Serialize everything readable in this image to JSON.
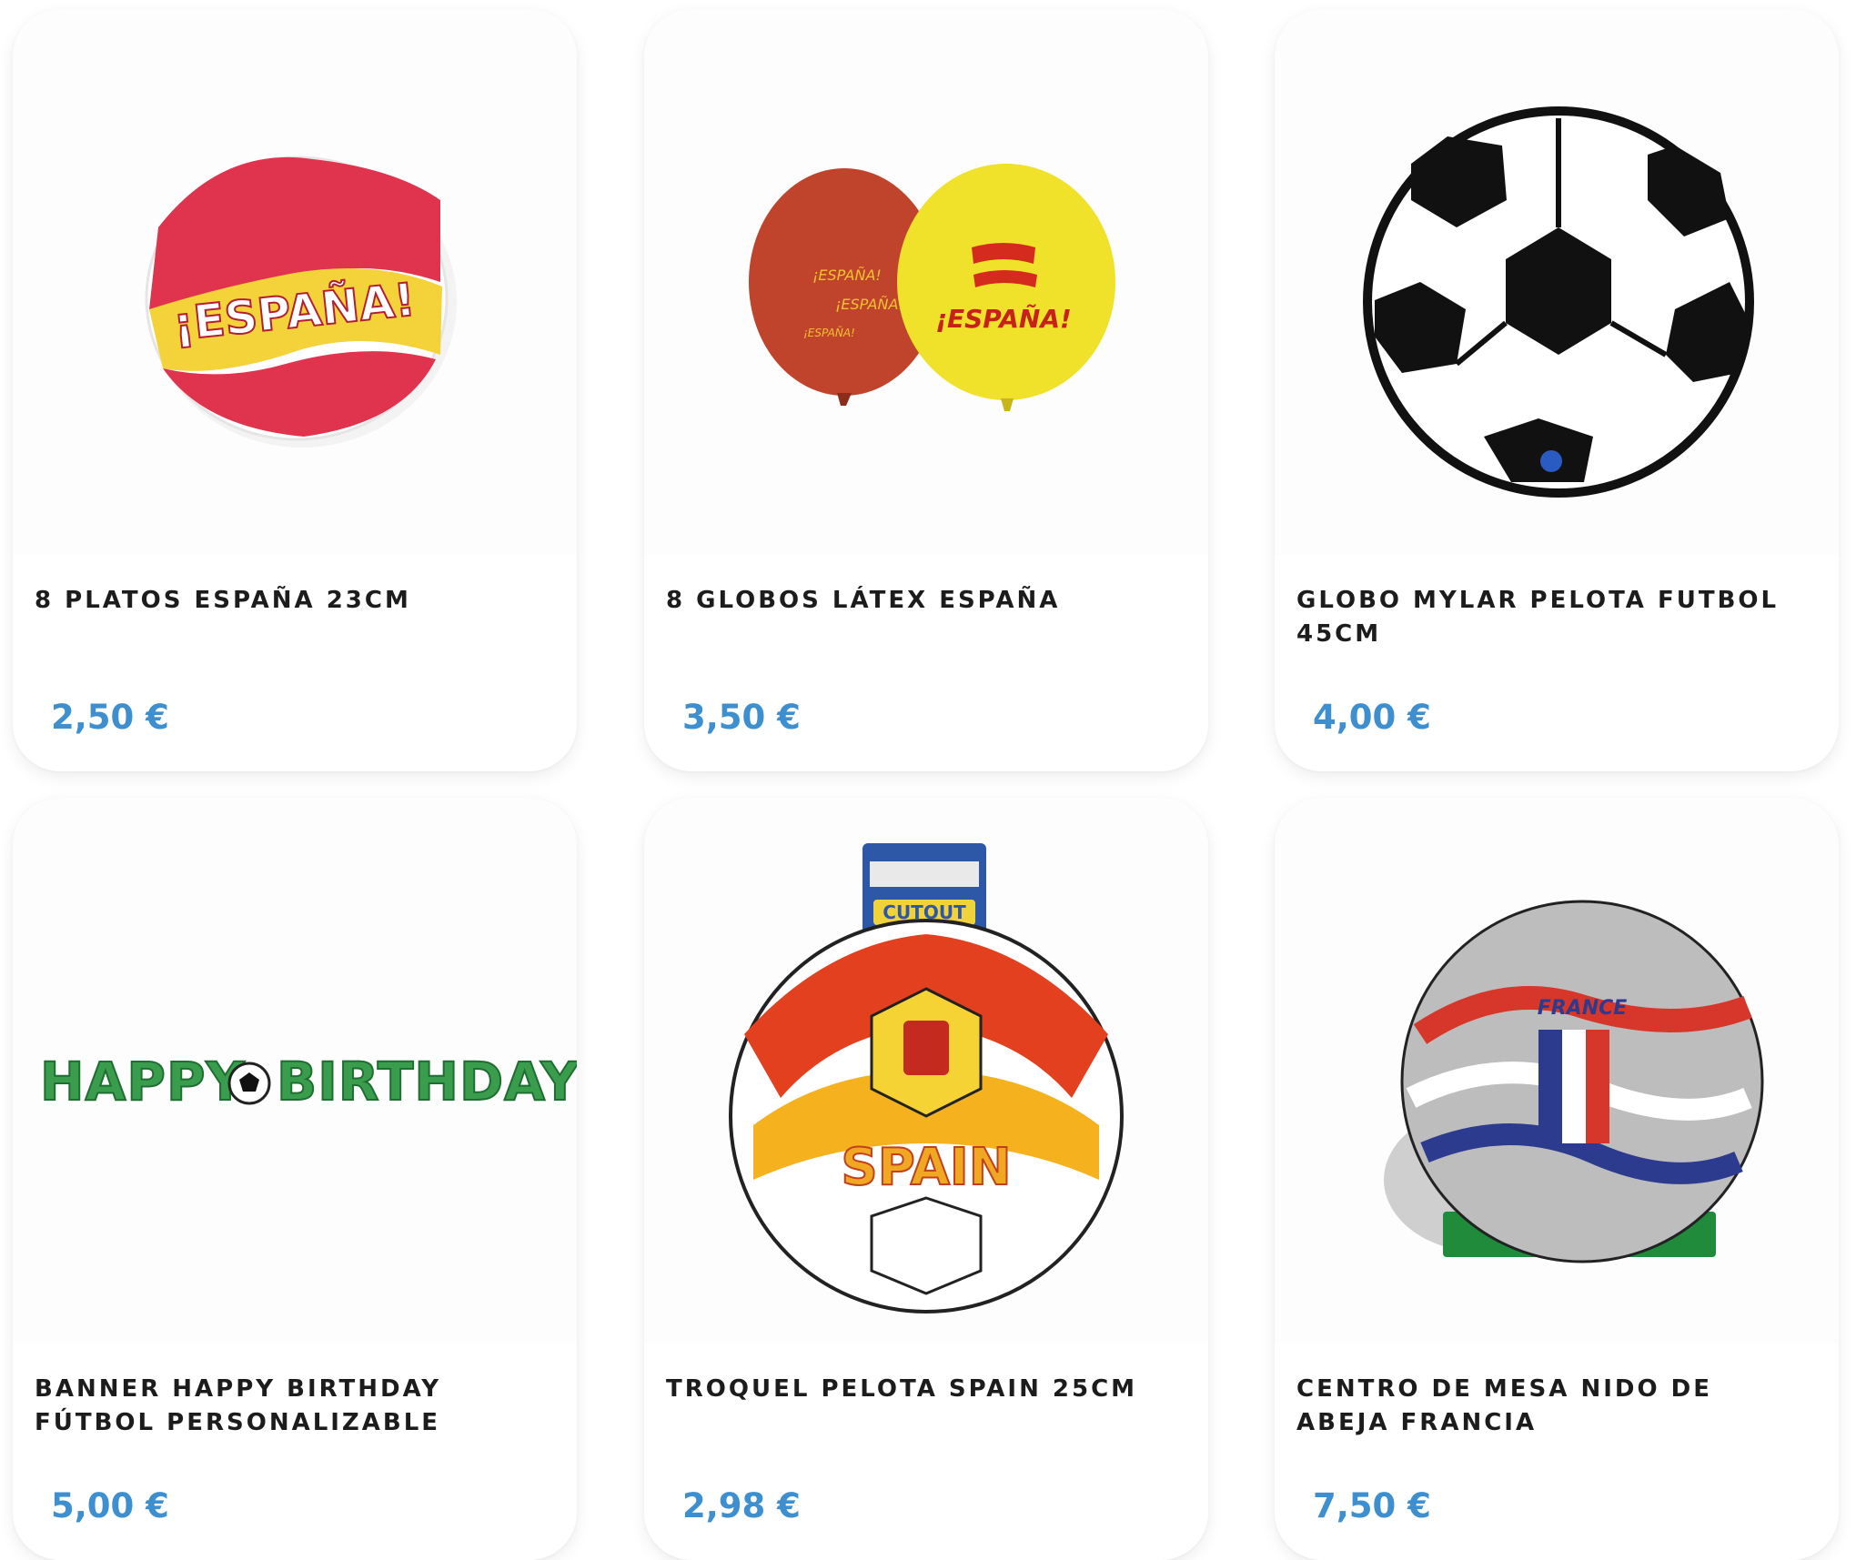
{
  "products": [
    {
      "title": "8 PLATOS ESPAÑA 23CM",
      "price": "2,50 €",
      "image_text": "¡ESPAÑA!",
      "image_subject": "plate-espana-flag"
    },
    {
      "title": "8 GLOBOS LÁTEX ESPAÑA",
      "price": "3,50 €",
      "image_text": "¡ESPAÑA!",
      "image_subject": "balloons-red-yellow"
    },
    {
      "title": "GLOBO MYLAR PELOTA FUTBOL 45CM",
      "price": "4,00 €",
      "image_subject": "foil-soccer-ball-balloon"
    },
    {
      "title": "BANNER HAPPY BIRTHDAY FÚTBOL PERSONALIZABLE",
      "price": "5,00 €",
      "image_text_left": "HAPPY",
      "image_text_right": "BIRTHDAY",
      "image_subject": "happy-birthday-banner"
    },
    {
      "title": "TROQUEL PELOTA SPAIN 25CM",
      "price": "2,98 €",
      "image_text": "SPAIN",
      "image_tag": "CUTOUT",
      "image_subject": "spain-ball-cutout"
    },
    {
      "title": "CENTRO DE MESA NIDO DE ABEJA FRANCIA",
      "price": "7,50 €",
      "image_text": "FRANCE",
      "image_subject": "france-ball-centerpiece"
    }
  ],
  "colors": {
    "price": "#3d8fd0",
    "title": "#1c1c1c",
    "spain_red": "#d9262b",
    "spain_yellow": "#f6c413",
    "france_blue": "#2d3b8f",
    "banner_green": "#3a9d4d"
  }
}
